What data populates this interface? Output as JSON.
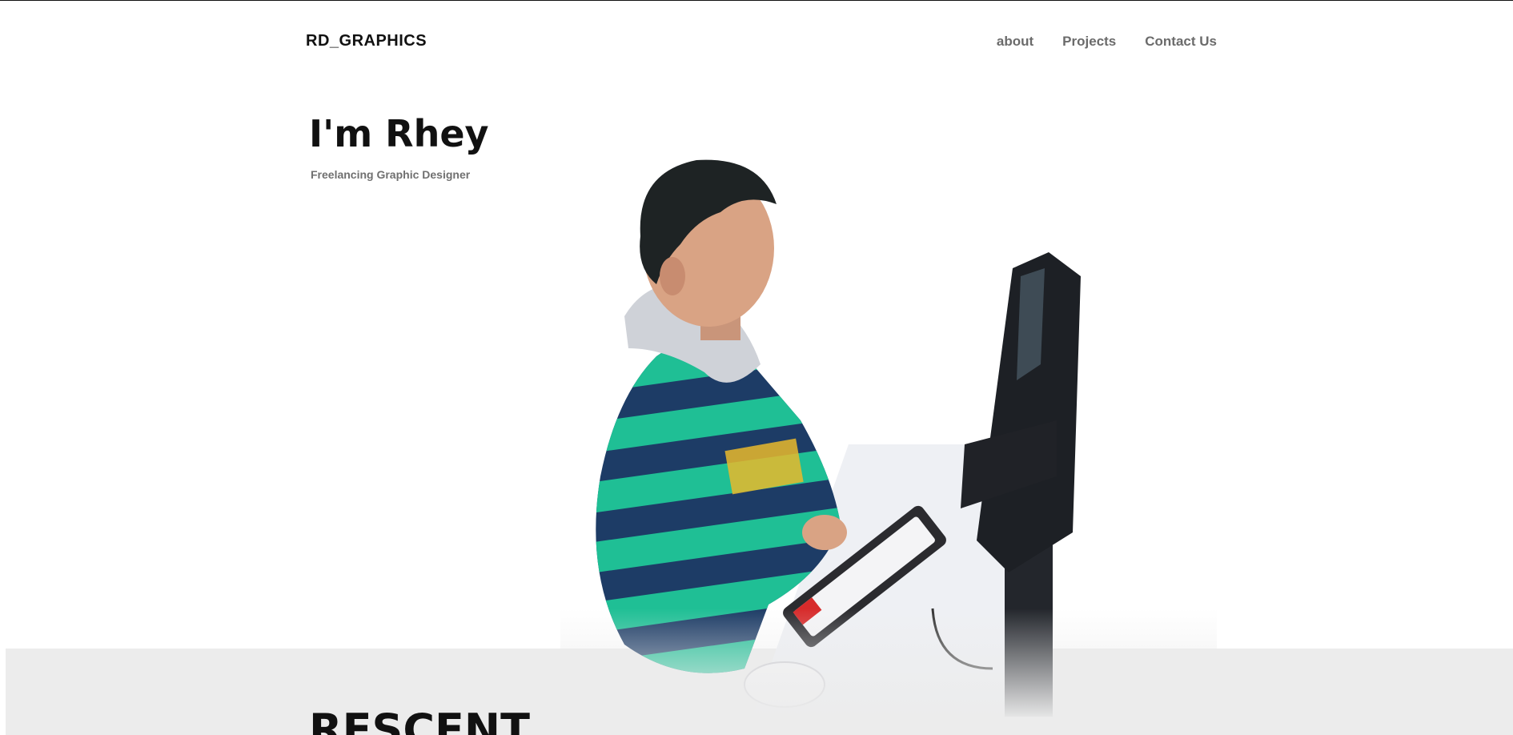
{
  "header": {
    "brand": "RD_GRAPHICS",
    "nav": [
      {
        "label": "about"
      },
      {
        "label": "Projects"
      },
      {
        "label": "Contact Us"
      }
    ]
  },
  "hero": {
    "title": "I'm Rhey",
    "subtitle": "Freelancing Graphic Designer",
    "image_icon": "designer-at-desk-illustration"
  },
  "recent": {
    "heading": "RESCENT"
  },
  "colors": {
    "text": "#111111",
    "nav_text": "#6b6b6b",
    "subtitle_text": "#707070",
    "band": "#ececec",
    "sweater_green": "#1fbf95",
    "sweater_navy": "#1d3c66"
  }
}
